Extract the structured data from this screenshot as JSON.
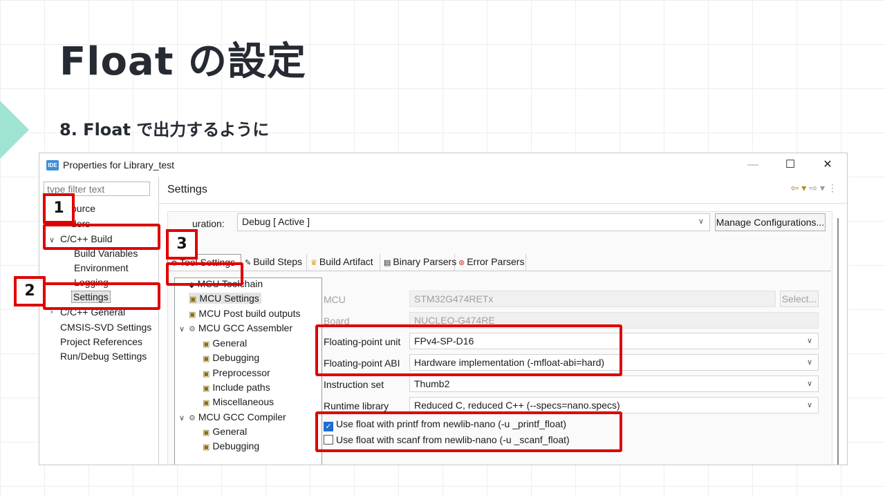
{
  "slide": {
    "title": "Float の設定",
    "subtitle": "8. Float で出力するように"
  },
  "window": {
    "icon_label": "IDE",
    "title": "Properties for Library_test",
    "minimize": "—",
    "maximize": "☐",
    "close": "✕"
  },
  "left_tree": {
    "filter_placeholder": "type filter text",
    "items": [
      "ource",
      "ders",
      "C/C++ Build",
      "Build Variables",
      "Environment",
      "Logging",
      "Settings",
      "C/C++ General",
      "CMSIS-SVD Settings",
      "Project References",
      "Run/Debug Settings"
    ]
  },
  "panel": {
    "title": "Settings",
    "config_label": "uration:",
    "config_value": "Debug  [ Active ]",
    "manage_button": "Manage Configurations..."
  },
  "tabs": [
    "Tool Settings",
    "Build Steps",
    "Build Artifact",
    "Binary Parsers",
    "Error Parsers"
  ],
  "tool_tree": [
    "MCU Toolchain",
    "MCU Settings",
    "MCU Post build outputs",
    "MCU GCC Assembler",
    "General",
    "Debugging",
    "Preprocessor",
    "Include paths",
    "Miscellaneous",
    "MCU GCC Compiler",
    "General",
    "Debugging"
  ],
  "form": {
    "mcu_label": "MCU",
    "mcu_value": "STM32G474RETx",
    "select_button": "Select...",
    "board_label": "Board",
    "board_value": "NUCLEO-G474RE",
    "fpu_label": "Floating-point unit",
    "fpu_value": "FPv4-SP-D16",
    "abi_label": "Floating-point ABI",
    "abi_value": "Hardware implementation (-mfloat-abi=hard)",
    "isa_label": "Instruction set",
    "isa_value": "Thumb2",
    "runtime_label": "Runtime library",
    "runtime_value": "Reduced C, reduced C++ (--specs=nano.specs)",
    "printf_float_label": "Use float with printf from newlib-nano (-u _printf_float)",
    "scanf_float_label": "Use float with scanf from newlib-nano (-u _scanf_float)"
  },
  "annotations": {
    "badge1": "1",
    "badge2": "2",
    "badge3": "3"
  },
  "icons": {
    "tab_tool_settings": "gear-icon",
    "tab_build_steps": "hammer-icon",
    "tab_build_artifact": "trophy-icon",
    "tab_binary_parsers": "binary-icon",
    "tab_error_parsers": "error-icon",
    "tree_folder": "settings-folder-icon"
  },
  "colors": {
    "annotation_red": "#e00000",
    "accent_teal": "#9fe3d2",
    "checkbox_blue": "#1f6bd1"
  }
}
